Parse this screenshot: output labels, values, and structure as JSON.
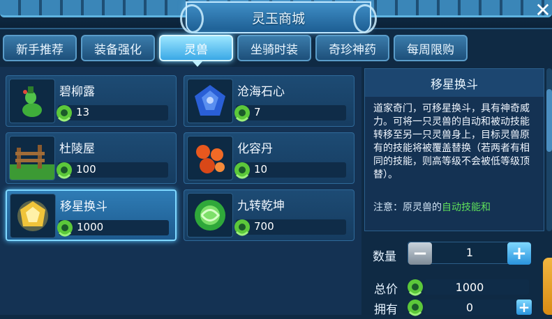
{
  "window": {
    "title": "灵玉商城"
  },
  "tabs": [
    {
      "label": "新手推荐"
    },
    {
      "label": "装备强化"
    },
    {
      "label": "灵兽"
    },
    {
      "label": "坐骑时装"
    },
    {
      "label": "奇珍神药"
    },
    {
      "label": "每周限购"
    }
  ],
  "active_tab": "灵兽",
  "items": [
    {
      "name": "碧柳露",
      "price": "13",
      "icon": "green-gourd-icon"
    },
    {
      "name": "沧海石心",
      "price": "7",
      "icon": "blue-crystal-icon"
    },
    {
      "name": "杜陵屋",
      "price": "100",
      "icon": "wooden-fence-icon"
    },
    {
      "name": "化容丹",
      "price": "10",
      "icon": "red-pills-icon"
    },
    {
      "name": "移星换斗",
      "price": "1000",
      "icon": "golden-gem-icon"
    },
    {
      "name": "九转乾坤",
      "price": "700",
      "icon": "green-orb-icon"
    }
  ],
  "detail": {
    "title": "移星换斗",
    "description": "道家奇门，可移星换斗，具有神奇威力。可将一只灵兽的自动和被动技能转移至另一只灵兽身上，目标灵兽原有的技能将被覆盖替换（若两者有相同的技能，则高等级不会被低等级顶替）。",
    "note_prefix": "注意：原灵兽的",
    "note_highlight": "自动技能和"
  },
  "purchase": {
    "qty_label": "数量",
    "qty_value": "1",
    "total_label": "总价",
    "total_value": "1000",
    "own_label": "拥有",
    "own_value": "0"
  },
  "colors": {
    "accent": "#3aa8e6",
    "highlight_green": "#5fe05a",
    "currency": "#5cc83a"
  }
}
